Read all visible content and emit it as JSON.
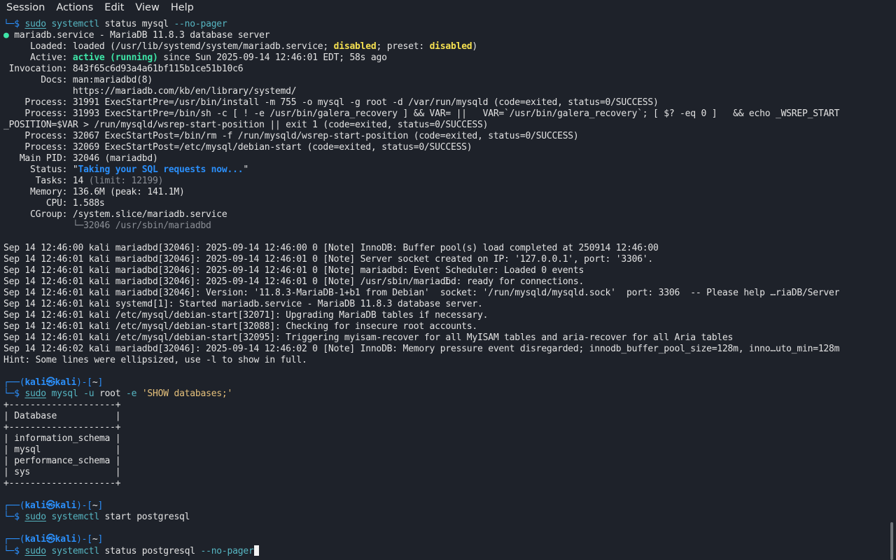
{
  "menu": [
    "Session",
    "Actions",
    "Edit",
    "View",
    "Help"
  ],
  "colors": {
    "background": "#1e222a",
    "text": "#e2e2e2",
    "prompt_blue": "#2b8ffa",
    "command_cyan": "#56b6c2",
    "active_green": "#3ee6a8",
    "disabled_yellow": "#f5e050",
    "string_yellow": "#e5c07b",
    "dim_gray": "#8b8f96"
  },
  "scroll": {
    "thumb_start_fraction": 0.93,
    "thumb_size_fraction": 0.07
  },
  "terminal": {
    "lines": [
      [
        [
          "└─$ ",
          "blue"
        ],
        [
          "sudo",
          "cmd"
        ],
        [
          " ",
          "def"
        ],
        [
          "systemctl",
          "cmd2"
        ],
        [
          " status mysql ",
          "white"
        ],
        [
          "--no-pager",
          "opt"
        ]
      ],
      [
        [
          "● ",
          "green"
        ],
        [
          "mariadb.service - MariaDB 11.8.3 database server",
          "def"
        ]
      ],
      [
        [
          "     Loaded: loaded (/usr/lib/systemd/system/mariadb.service; ",
          "def"
        ],
        [
          "disabled",
          "yellow_b"
        ],
        [
          "; preset: ",
          "def"
        ],
        [
          "disabled",
          "yellow_b"
        ],
        [
          ")",
          "def"
        ]
      ],
      [
        [
          "     Active: ",
          "def"
        ],
        [
          "active (running)",
          "green_b"
        ],
        [
          " since Sun 2025-09-14 12:46:01 EDT; 58s ago",
          "def"
        ]
      ],
      [
        [
          " Invocation: 843f65c6d93a4a61bf115b1ce51b10c6",
          "def"
        ]
      ],
      [
        [
          "       Docs: man:mariadbd(8)",
          "def"
        ]
      ],
      [
        [
          "             https://mariadb.com/kb/en/library/systemd/",
          "def"
        ]
      ],
      [
        [
          "    Process: 31991 ExecStartPre=/usr/bin/install -m 755 -o mysql -g root -d /var/run/mysqld (code=exited, status=0/SUCCESS)",
          "def"
        ]
      ],
      [
        [
          "    Process: 31993 ExecStartPre=/bin/sh -c [ ! -e /usr/bin/galera_recovery ] && VAR= ||   VAR=`/usr/bin/galera_recovery`; [ $? -eq 0 ]   && echo _WSREP_START",
          "def"
        ]
      ],
      [
        [
          "_POSITION=$VAR > /run/mysqld/wsrep-start-position || exit 1 (code=exited, status=0/SUCCESS)",
          "def"
        ]
      ],
      [
        [
          "    Process: 32067 ExecStartPost=/bin/rm -f /run/mysqld/wsrep-start-position (code=exited, status=0/SUCCESS)",
          "def"
        ]
      ],
      [
        [
          "    Process: 32069 ExecStartPost=/etc/mysql/debian-start (code=exited, status=0/SUCCESS)",
          "def"
        ]
      ],
      [
        [
          "   Main PID: 32046 (mariadbd)",
          "def"
        ]
      ],
      [
        [
          "     Status: \"",
          "def"
        ],
        [
          "Taking your SQL requests now...",
          "status"
        ],
        [
          "\"",
          "def"
        ]
      ],
      [
        [
          "      Tasks: 14 ",
          "def"
        ],
        [
          "(limit: 12199)",
          "gray"
        ]
      ],
      [
        [
          "     Memory: 136.6M (peak: 141.1M)",
          "def"
        ]
      ],
      [
        [
          "        CPU: 1.588s",
          "def"
        ]
      ],
      [
        [
          "     CGroup: /system.slice/mariadb.service",
          "def"
        ]
      ],
      [
        [
          "             ",
          "def"
        ],
        [
          "└─32046 /usr/sbin/mariadbd",
          "gray"
        ]
      ],
      [
        [
          "",
          "def"
        ]
      ],
      [
        [
          "Sep 14 12:46:00 kali mariadbd[32046]: 2025-09-14 12:46:00 0 [Note] InnoDB: Buffer pool(s) load completed at 250914 12:46:00",
          "def"
        ]
      ],
      [
        [
          "Sep 14 12:46:01 kali mariadbd[32046]: 2025-09-14 12:46:01 0 [Note] Server socket created on IP: '127.0.0.1', port: '3306'.",
          "def"
        ]
      ],
      [
        [
          "Sep 14 12:46:01 kali mariadbd[32046]: 2025-09-14 12:46:01 0 [Note] mariadbd: Event Scheduler: Loaded 0 events",
          "def"
        ]
      ],
      [
        [
          "Sep 14 12:46:01 kali mariadbd[32046]: 2025-09-14 12:46:01 0 [Note] /usr/sbin/mariadbd: ready for connections.",
          "def"
        ]
      ],
      [
        [
          "Sep 14 12:46:01 kali mariadbd[32046]: Version: '11.8.3-MariaDB-1+b1 from Debian'  socket: '/run/mysqld/mysqld.sock'  port: 3306  -- Please help …riaDB/Server",
          "def"
        ]
      ],
      [
        [
          "Sep 14 12:46:01 kali systemd[1]: Started mariadb.service - MariaDB 11.8.3 database server.",
          "def"
        ]
      ],
      [
        [
          "Sep 14 12:46:01 kali /etc/mysql/debian-start[32071]: Upgrading MariaDB tables if necessary.",
          "def"
        ]
      ],
      [
        [
          "Sep 14 12:46:01 kali /etc/mysql/debian-start[32088]: Checking for insecure root accounts.",
          "def"
        ]
      ],
      [
        [
          "Sep 14 12:46:01 kali /etc/mysql/debian-start[32095]: Triggering myisam-recover for all MyISAM tables and aria-recover for all Aria tables",
          "def"
        ]
      ],
      [
        [
          "Sep 14 12:46:02 kali mariadbd[32046]: 2025-09-14 12:46:02 0 [Note] InnoDB: Memory pressure event disregarded; innodb_buffer_pool_size=128m, inno…uto_min=128m",
          "def"
        ]
      ],
      [
        [
          "Hint: Some lines were ellipsized, use -l to show in full.",
          "def"
        ]
      ],
      [
        [
          "",
          "def"
        ]
      ],
      [
        [
          "┌──(",
          "blue"
        ],
        [
          "kali㉿kali",
          "blue_b"
        ],
        [
          ")-[",
          "blue"
        ],
        [
          "~",
          "white"
        ],
        [
          "]",
          "blue"
        ]
      ],
      [
        [
          "└─$ ",
          "blue"
        ],
        [
          "sudo",
          "cmd"
        ],
        [
          " ",
          "def"
        ],
        [
          "mysql",
          "cmd2"
        ],
        [
          " ",
          "def"
        ],
        [
          "-u",
          "opt"
        ],
        [
          " root ",
          "white"
        ],
        [
          "-e",
          "opt"
        ],
        [
          " ",
          "def"
        ],
        [
          "'SHOW databases;'",
          "str"
        ]
      ],
      [
        [
          "+--------------------+",
          "def"
        ]
      ],
      [
        [
          "| Database           |",
          "def"
        ]
      ],
      [
        [
          "+--------------------+",
          "def"
        ]
      ],
      [
        [
          "| information_schema |",
          "def"
        ]
      ],
      [
        [
          "| mysql              |",
          "def"
        ]
      ],
      [
        [
          "| performance_schema |",
          "def"
        ]
      ],
      [
        [
          "| sys                |",
          "def"
        ]
      ],
      [
        [
          "+--------------------+",
          "def"
        ]
      ],
      [
        [
          "",
          "def"
        ]
      ],
      [
        [
          "┌──(",
          "blue"
        ],
        [
          "kali㉿kali",
          "blue_b"
        ],
        [
          ")-[",
          "blue"
        ],
        [
          "~",
          "white"
        ],
        [
          "]",
          "blue"
        ]
      ],
      [
        [
          "└─$ ",
          "blue"
        ],
        [
          "sudo",
          "cmd"
        ],
        [
          " ",
          "def"
        ],
        [
          "systemctl",
          "cmd2"
        ],
        [
          " start postgresql",
          "white"
        ]
      ],
      [
        [
          "",
          "def"
        ]
      ],
      [
        [
          "┌──(",
          "blue"
        ],
        [
          "kali㉿kali",
          "blue_b"
        ],
        [
          ")-[",
          "blue"
        ],
        [
          "~",
          "white"
        ],
        [
          "]",
          "blue"
        ]
      ],
      [
        [
          "└─$ ",
          "blue"
        ],
        [
          "sudo",
          "cmd"
        ],
        [
          " ",
          "def"
        ],
        [
          "systemctl",
          "cmd2"
        ],
        [
          " status postgresql ",
          "white"
        ],
        [
          "--no-pager",
          "opt"
        ]
      ]
    ]
  }
}
